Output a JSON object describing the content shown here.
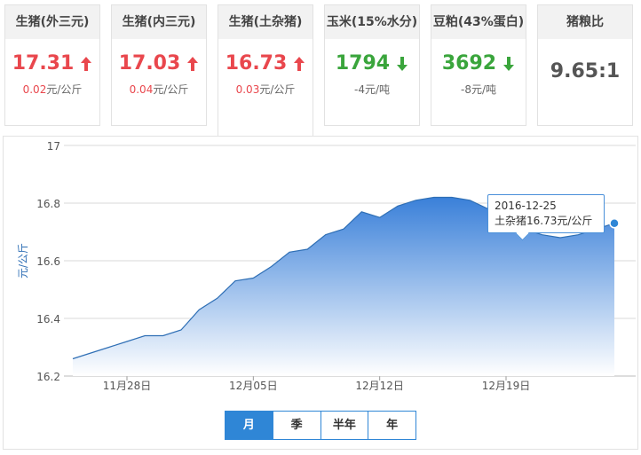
{
  "cards": [
    {
      "title": "生猪(外三元)",
      "value": "17.31",
      "trend": "up",
      "change_num": "0.02",
      "change_unit": "元/公斤"
    },
    {
      "title": "生猪(内三元)",
      "value": "17.03",
      "trend": "up",
      "change_num": "0.04",
      "change_unit": "元/公斤"
    },
    {
      "title": "生猪(土杂猪)",
      "value": "16.73",
      "trend": "up",
      "change_num": "0.03",
      "change_unit": "元/公斤"
    },
    {
      "title": "玉米(15%水分)",
      "value": "1794",
      "trend": "down",
      "change_num": "-4",
      "change_unit": "元/吨"
    },
    {
      "title": "豆粕(43%蛋白)",
      "value": "3692",
      "trend": "down",
      "change_num": "-8",
      "change_unit": "元/吨"
    },
    {
      "title": "猪粮比",
      "value": "9.65:1",
      "trend": "none",
      "change_num": "",
      "change_unit": ""
    }
  ],
  "colors": {
    "up": "#e9474d",
    "down": "#3aa53c",
    "accent": "#2f86d6",
    "area_top": "#3a80d9",
    "area_bottom": "#ffffff"
  },
  "tooltip": {
    "date": "2016-12-25",
    "label": "土杂猪16.73元/公斤"
  },
  "range_tabs": [
    {
      "label": "月",
      "selected": true
    },
    {
      "label": "季",
      "selected": false
    },
    {
      "label": "半年",
      "selected": false
    },
    {
      "label": "年",
      "selected": false
    }
  ],
  "chart_data": {
    "type": "area",
    "ylabel": "元/公斤",
    "ylim": [
      16.2,
      17.0
    ],
    "yticks": [
      16.2,
      16.4,
      16.6,
      16.8,
      17.0
    ],
    "ytick_labels": [
      "16.2",
      "16.4",
      "16.6",
      "16.8",
      "17"
    ],
    "xtick_labels": [
      {
        "label": "11月28日",
        "date": "2016-11-28"
      },
      {
        "label": "12月05日",
        "date": "2016-12-05"
      },
      {
        "label": "12月12日",
        "date": "2016-12-12"
      },
      {
        "label": "12月19日",
        "date": "2016-12-19"
      }
    ],
    "grid": true,
    "series": [
      {
        "name": "土杂猪",
        "points": [
          [
            "2016-11-25",
            16.26
          ],
          [
            "2016-11-26",
            16.28
          ],
          [
            "2016-11-27",
            16.3
          ],
          [
            "2016-11-28",
            16.32
          ],
          [
            "2016-11-29",
            16.34
          ],
          [
            "2016-11-30",
            16.34
          ],
          [
            "2016-12-01",
            16.36
          ],
          [
            "2016-12-02",
            16.43
          ],
          [
            "2016-12-03",
            16.47
          ],
          [
            "2016-12-04",
            16.53
          ],
          [
            "2016-12-05",
            16.54
          ],
          [
            "2016-12-06",
            16.58
          ],
          [
            "2016-12-07",
            16.63
          ],
          [
            "2016-12-08",
            16.64
          ],
          [
            "2016-12-09",
            16.69
          ],
          [
            "2016-12-10",
            16.71
          ],
          [
            "2016-12-11",
            16.77
          ],
          [
            "2016-12-12",
            16.75
          ],
          [
            "2016-12-13",
            16.79
          ],
          [
            "2016-12-14",
            16.81
          ],
          [
            "2016-12-15",
            16.82
          ],
          [
            "2016-12-16",
            16.82
          ],
          [
            "2016-12-17",
            16.81
          ],
          [
            "2016-12-18",
            16.78
          ],
          [
            "2016-12-19",
            16.74
          ],
          [
            "2016-12-20",
            16.71
          ],
          [
            "2016-12-21",
            16.69
          ],
          [
            "2016-12-22",
            16.68
          ],
          [
            "2016-12-23",
            16.69
          ],
          [
            "2016-12-24",
            16.71
          ],
          [
            "2016-12-25",
            16.73
          ]
        ]
      }
    ]
  }
}
